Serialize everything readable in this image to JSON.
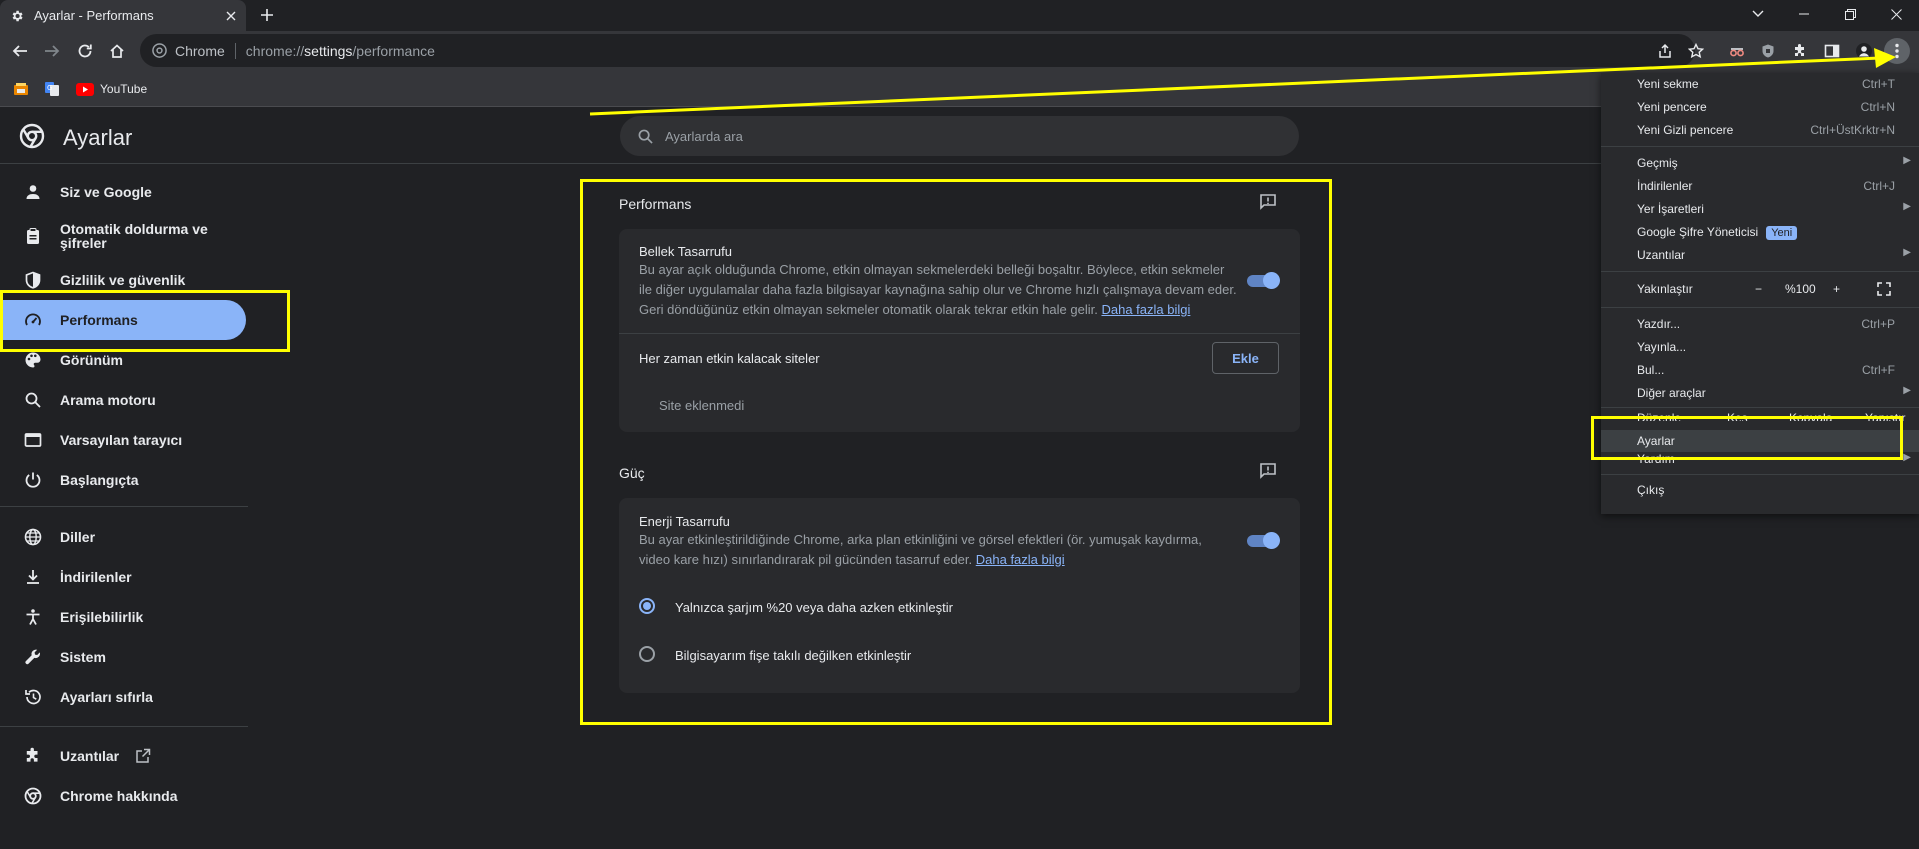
{
  "tab": {
    "title": "Ayarlar - Performans"
  },
  "toolbar": {
    "omnibox_chip": "Chrome",
    "url_scheme": "chrome://",
    "url_host": "settings",
    "url_path": "/performance"
  },
  "bookmarks": [
    {
      "label": ""
    },
    {
      "label": ""
    },
    {
      "label": "YouTube"
    }
  ],
  "header": {
    "title": "Ayarlar",
    "search_placeholder": "Ayarlarda ara"
  },
  "nav": {
    "items": [
      {
        "label": "Siz ve Google"
      },
      {
        "label": "Otomatik doldurma ve şifreler"
      },
      {
        "label": "Gizlilik ve güvenlik"
      },
      {
        "label": "Performans"
      },
      {
        "label": "Görünüm"
      },
      {
        "label": "Arama motoru"
      },
      {
        "label": "Varsayılan tarayıcı"
      },
      {
        "label": "Başlangıçta"
      },
      {
        "label": "Diller"
      },
      {
        "label": "İndirilenler"
      },
      {
        "label": "Erişilebilirlik"
      },
      {
        "label": "Sistem"
      },
      {
        "label": "Ayarları sıfırla"
      },
      {
        "label": "Uzantılar"
      },
      {
        "label": "Chrome hakkında"
      }
    ]
  },
  "performance": {
    "title": "Performans",
    "memory": {
      "title": "Bellek Tasarrufu",
      "desc1": "Bu ayar açık olduğunda Chrome, etkin olmayan sekmelerdeki belleği boşaltır. Böylece, etkin sekmeler",
      "desc2": "ile diğer uygulamalar daha fazla bilgisayar kaynağına sahip olur ve Chrome hızlı çalışmaya devam eder.",
      "desc3": "Geri döndüğünüz etkin olmayan sekmeler otomatik olarak tekrar etkin hale gelir.",
      "link": "Daha fazla bilgi",
      "enabled": true
    },
    "always_active": {
      "title": "Her zaman etkin kalacak siteler",
      "button": "Ekle",
      "empty": "Site eklenmedi"
    }
  },
  "power": {
    "title": "Güç",
    "energy": {
      "title": "Enerji Tasarrufu",
      "desc1": "Bu ayar etkinleştirildiğinde Chrome, arka plan etkinliğini ve görsel efektleri (ör. yumuşak kaydırma,",
      "desc2": "video kare hızı) sınırlandırarak pil gücünden tasarruf eder.",
      "link": "Daha fazla bilgi",
      "enabled": true
    },
    "options": [
      {
        "label": "Yalnızca şarjım %20 veya daha azken etkinleştir",
        "selected": true
      },
      {
        "label": "Bilgisayarım fişe takılı değilken etkinleştir",
        "selected": false
      }
    ]
  },
  "menu": {
    "new_tab": {
      "label": "Yeni sekme",
      "shortcut": "Ctrl+T"
    },
    "new_window": {
      "label": "Yeni pencere",
      "shortcut": "Ctrl+N"
    },
    "new_incognito": {
      "label": "Yeni Gizli pencere",
      "shortcut": "Ctrl+ÜstKrktr+N"
    },
    "history": {
      "label": "Geçmiş"
    },
    "downloads": {
      "label": "İndirilenler",
      "shortcut": "Ctrl+J"
    },
    "bookmarks": {
      "label": "Yer İşaretleri"
    },
    "password_manager": {
      "label": "Google Şifre Yöneticisi",
      "badge": "Yeni"
    },
    "extensions": {
      "label": "Uzantılar"
    },
    "zoom": {
      "label": "Yakınlaştır",
      "minus": "−",
      "value": "%100",
      "plus": "+"
    },
    "print": {
      "label": "Yazdır...",
      "shortcut": "Ctrl+P"
    },
    "cast": {
      "label": "Yayınla..."
    },
    "find": {
      "label": "Bul...",
      "shortcut": "Ctrl+F"
    },
    "more_tools": {
      "label": "Diğer araçlar"
    },
    "edit": {
      "label": "Düzenle",
      "cut": "Kes",
      "copy": "Kopyala",
      "paste": "Yapıştır"
    },
    "settings": {
      "label": "Ayarlar"
    },
    "help": {
      "label": "Yardım"
    },
    "exit": {
      "label": "Çıkış"
    }
  },
  "colors": {
    "accent": "#8ab4f8",
    "highlight": "#ffff00",
    "background": "#202124"
  }
}
